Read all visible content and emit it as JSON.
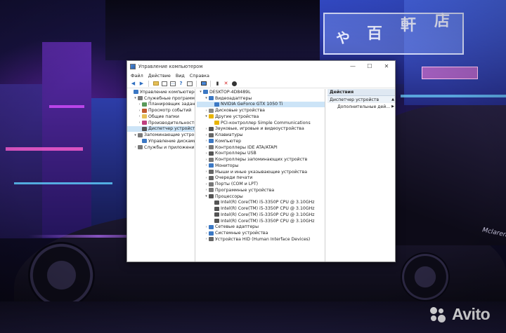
{
  "window": {
    "title": "Управление компьютером",
    "controls": {
      "minimize": "—",
      "maximize": "☐",
      "close": "✕"
    }
  },
  "menu": [
    "Файл",
    "Действие",
    "Вид",
    "Справка"
  ],
  "left_tree": [
    {
      "label": "Управление компьютером (л",
      "level": 0,
      "expander": "",
      "icon": "computer-management-icon"
    },
    {
      "label": "Служебные программы",
      "level": 1,
      "expander": "▾",
      "icon": "tools-icon"
    },
    {
      "label": "Планировщик заданий",
      "level": 2,
      "expander": "›",
      "icon": "clock-icon"
    },
    {
      "label": "Просмотр событий",
      "level": 2,
      "expander": "›",
      "icon": "event-viewer-icon"
    },
    {
      "label": "Общие папки",
      "level": 2,
      "expander": "›",
      "icon": "folder-icon"
    },
    {
      "label": "Производительность",
      "level": 2,
      "expander": "›",
      "icon": "performance-icon"
    },
    {
      "label": "Диспетчер устройств",
      "level": 2,
      "expander": "",
      "icon": "device-manager-icon",
      "selected": true
    },
    {
      "label": "Запоминающие устройств",
      "level": 1,
      "expander": "▾",
      "icon": "storage-icon"
    },
    {
      "label": "Управление дисками",
      "level": 2,
      "expander": "",
      "icon": "disk-icon"
    },
    {
      "label": "Службы и приложения",
      "level": 1,
      "expander": "›",
      "icon": "services-icon"
    }
  ],
  "device_tree": [
    {
      "label": "DESKTOP-4D8489L",
      "level": 0,
      "expander": "▾",
      "icon": "computer-icon"
    },
    {
      "label": "Видеоадаптеры",
      "level": 1,
      "expander": "▾",
      "icon": "display-adapter-icon"
    },
    {
      "label": "NVIDIA GeForce GTX 1050 Ti",
      "level": 2,
      "expander": "",
      "icon": "gpu-icon",
      "selected": true
    },
    {
      "label": "Дисковые устройства",
      "level": 1,
      "expander": "›",
      "icon": "disk-drive-icon"
    },
    {
      "label": "Другие устройства",
      "level": 1,
      "expander": "▾",
      "icon": "other-devices-icon"
    },
    {
      "label": "PCI-контроллер Simple Communications",
      "level": 2,
      "expander": "",
      "icon": "warning-device-icon"
    },
    {
      "label": "Звуковые, игровые и видеоустройства",
      "level": 1,
      "expander": "›",
      "icon": "sound-icon"
    },
    {
      "label": "Клавиатуры",
      "level": 1,
      "expander": "›",
      "icon": "keyboard-icon"
    },
    {
      "label": "Компьютер",
      "level": 1,
      "expander": "›",
      "icon": "computer-icon"
    },
    {
      "label": "Контроллеры IDE ATA/ATAPI",
      "level": 1,
      "expander": "›",
      "icon": "ide-icon"
    },
    {
      "label": "Контроллеры USB",
      "level": 1,
      "expander": "›",
      "icon": "usb-icon"
    },
    {
      "label": "Контроллеры запоминающих устройств",
      "level": 1,
      "expander": "›",
      "icon": "storage-controller-icon"
    },
    {
      "label": "Мониторы",
      "level": 1,
      "expander": "›",
      "icon": "monitor-icon"
    },
    {
      "label": "Мыши и иные указывающие устройства",
      "level": 1,
      "expander": "›",
      "icon": "mouse-icon"
    },
    {
      "label": "Очереди печати",
      "level": 1,
      "expander": "›",
      "icon": "printer-icon"
    },
    {
      "label": "Порты (COM и LPT)",
      "level": 1,
      "expander": "›",
      "icon": "port-icon"
    },
    {
      "label": "Программные устройства",
      "level": 1,
      "expander": "›",
      "icon": "software-device-icon"
    },
    {
      "label": "Процессоры",
      "level": 1,
      "expander": "▾",
      "icon": "cpu-icon"
    },
    {
      "label": "Intel(R) Core(TM) i5-3350P CPU @ 3.10GHz",
      "level": 2,
      "expander": "",
      "icon": "cpu-icon"
    },
    {
      "label": "Intel(R) Core(TM) i5-3350P CPU @ 3.10GHz",
      "level": 2,
      "expander": "",
      "icon": "cpu-icon"
    },
    {
      "label": "Intel(R) Core(TM) i5-3350P CPU @ 3.10GHz",
      "level": 2,
      "expander": "",
      "icon": "cpu-icon"
    },
    {
      "label": "Intel(R) Core(TM) i5-3350P CPU @ 3.10GHz",
      "level": 2,
      "expander": "",
      "icon": "cpu-icon"
    },
    {
      "label": "Сетевые адаптеры",
      "level": 1,
      "expander": "›",
      "icon": "network-icon"
    },
    {
      "label": "Системные устройства",
      "level": 1,
      "expander": "›",
      "icon": "system-device-icon"
    },
    {
      "label": "Устройства HID (Human Interface Devices)",
      "level": 1,
      "expander": "›",
      "icon": "hid-icon"
    }
  ],
  "actions": {
    "header": "Действия",
    "section": "Диспетчер устройств",
    "section_arrow": "▲",
    "item": "Дополнительные дей...",
    "item_arrow": "▶"
  },
  "wallpaper": {
    "signs": [
      "や",
      "百",
      "軒",
      "店"
    ],
    "car_badge": "Mclaren",
    "watermark": "Avito"
  },
  "colors": {
    "selection": "#cce4f7",
    "actions_header": "#dfe8f2",
    "icon_blue": "#3b78c4",
    "icon_gray": "#7a7a7a",
    "warning_yellow": "#e8b400"
  }
}
